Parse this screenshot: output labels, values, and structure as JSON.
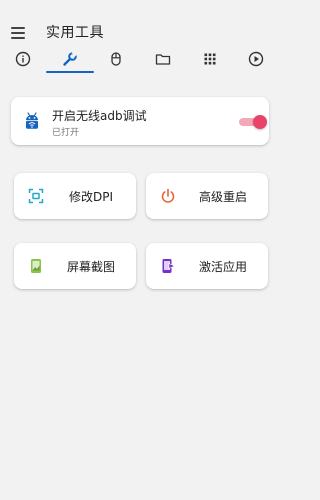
{
  "app_bar": {
    "title": "实用工具"
  },
  "tabs": [
    {
      "icon": "info-icon"
    },
    {
      "icon": "wrench-icon",
      "selected": true
    },
    {
      "icon": "mouse-icon"
    },
    {
      "icon": "folder-icon"
    },
    {
      "icon": "grid-icon"
    },
    {
      "icon": "play-circle-icon"
    }
  ],
  "adb": {
    "title": "开启无线adb调试",
    "status": "已打开",
    "enabled": true,
    "accent": "#e8446a"
  },
  "tools": [
    {
      "label": "修改DPI",
      "icon": "screen-resize-icon",
      "color": "#26a6c9"
    },
    {
      "label": "高级重启",
      "icon": "power-icon",
      "color": "#e0683a"
    },
    {
      "label": "屏幕截图",
      "icon": "screenshot-icon",
      "color": "#8bc34a"
    },
    {
      "label": "激活应用",
      "icon": "activate-app-icon",
      "color": "#7b2fc9"
    }
  ]
}
